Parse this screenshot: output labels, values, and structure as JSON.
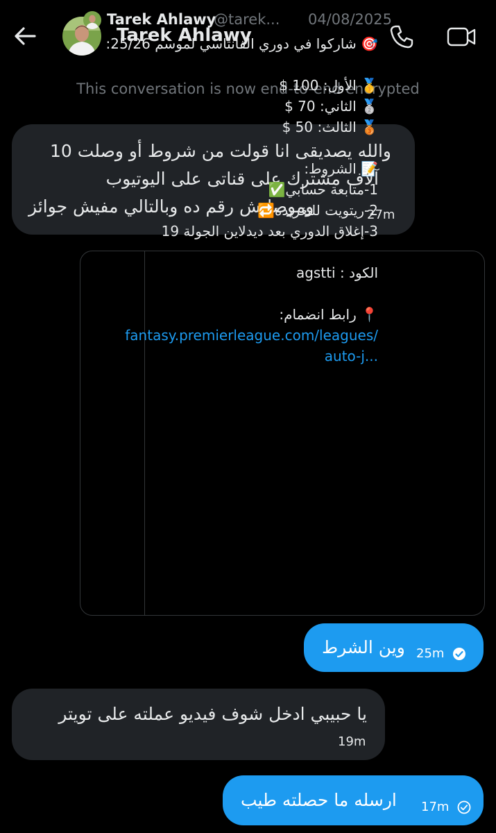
{
  "header": {
    "name": "Tarek Ahlawy",
    "avatar_icon": "profile-photo",
    "call_icon": "phone-icon",
    "video_icon": "video-camera-icon"
  },
  "system_message": "This conversation is now end-to-end encrypted",
  "messages": [
    {
      "direction": "incoming",
      "lines": [
        "والله يصديقى انا قولت من شروط أو وصلت 10",
        "آلاف مشترك على قناتى على اليوتيوب",
        "وموصلتش رقم ده وبالتالي مفيش جوائز"
      ],
      "time": "27m"
    },
    {
      "direction": "outgoing",
      "text": "وين الشرط",
      "time": "25m",
      "status_icon": "check-circle-filled-icon"
    },
    {
      "direction": "incoming",
      "text": "يا حبيبي ادخل شوف فيديو عملته على تويتر",
      "time": "19m"
    },
    {
      "direction": "outgoing",
      "text": "ارسله ما حصلته طيب",
      "time": "17m",
      "status_icon": "check-circle-outline-icon"
    }
  ],
  "quoted_post": {
    "author": "Tarek Ahlawy",
    "handle": "@tarek...",
    "date": "04/08/2025",
    "lines": [
      "🎯 شاركوا في دوري الفانتاسي لموسم 25/26:",
      "",
      "🥇 الأول: 100 $",
      "🥈 الثاني: 70 $",
      "🥉 الثالث: 50 $",
      "",
      "📝 الشروط:",
      "1-متابعة حسابي✅",
      "2-ريتويت للتغريدة🔁",
      "3-إغلاق الدوري بعد ديدلاين الجولة 19",
      "",
      "الكود : agstti",
      "",
      "📍 رابط انضمام:"
    ],
    "link_line1": "fantasy.premierleague.com/leagues/",
    "link_line2": "auto-j..."
  }
}
